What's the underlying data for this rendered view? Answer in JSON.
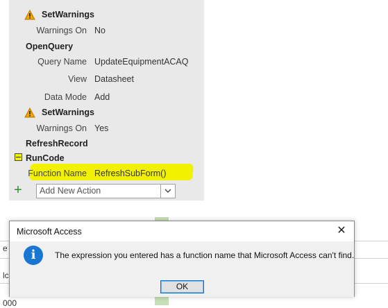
{
  "macro": {
    "actions": [
      {
        "name": "SetWarnings",
        "args": [
          {
            "label": "Warnings On",
            "value": "No"
          }
        ]
      },
      {
        "name": "OpenQuery",
        "args": [
          {
            "label": "Query Name",
            "value": "UpdateEquipmentACAQ"
          },
          {
            "label": "View",
            "value": "Datasheet"
          },
          {
            "label": "Data Mode",
            "value": "Add"
          }
        ]
      },
      {
        "name": "SetWarnings",
        "args": [
          {
            "label": "Warnings On",
            "value": "Yes"
          }
        ]
      },
      {
        "name": "RefreshRecord",
        "args": []
      },
      {
        "name": "RunCode",
        "args": [
          {
            "label": "Function Name",
            "value": "RefreshSubForm()"
          }
        ]
      }
    ],
    "add_action_placeholder": "Add New Action",
    "highlight_color": "#f2f200"
  },
  "background": {
    "fragments": [
      "e",
      "lc",
      "000"
    ]
  },
  "dialog": {
    "title": "Microsoft Access",
    "close_label": "✕",
    "icon_glyph": "i",
    "message": "The expression you entered has a function name that Microsoft Access can't find.",
    "ok_label": "OK"
  }
}
